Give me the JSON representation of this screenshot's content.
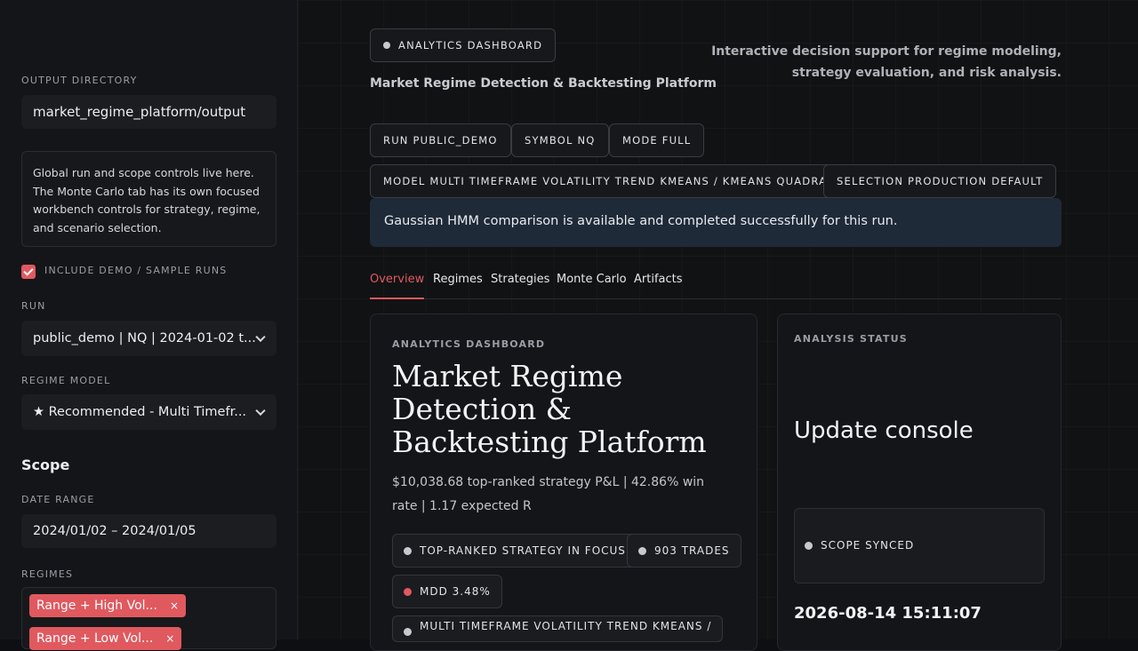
{
  "sidebar": {
    "output_directory_label": "OUTPUT DIRECTORY",
    "output_directory_value": "market_regime_platform/output",
    "note": "Global run and scope controls live here. The Monte Carlo tab has its own focused workbench controls for strategy, regime, and scenario selection.",
    "include_demo_label": "INCLUDE DEMO / SAMPLE RUNS",
    "include_demo_checked": true,
    "run_label": "RUN",
    "run_value": "public_demo | NQ | 2024-01-02 t...",
    "regime_model_label": "REGIME MODEL",
    "regime_model_value": "★ Recommended - Multi Timefr...",
    "scope_heading": "Scope",
    "date_range_label": "DATE RANGE",
    "date_range_value": "2024/01/02 – 2024/01/05",
    "regimes_label": "REGIMES",
    "regime_tags": [
      "Range + High Vol...",
      "Range + Low Vol..."
    ],
    "tag_remove": "×"
  },
  "header": {
    "badge": "ANALYTICS DASHBOARD",
    "subtitle": "Market Regime Detection & Backtesting Platform",
    "description": "Interactive decision support for regime modeling, strategy evaluation, and risk analysis.",
    "chips": [
      "RUN PUBLIC_DEMO",
      "SYMBOL NQ",
      "MODE FULL",
      "MODEL MULTI TIMEFRAME VOLATILITY TREND KMEANS / KMEANS QUADRANT",
      "SELECTION PRODUCTION DEFAULT"
    ],
    "banner": "Gaussian HMM comparison is available and completed successfully for this run."
  },
  "tabs": [
    "Overview",
    "Regimes",
    "Strategies",
    "Monte Carlo",
    "Artifacts"
  ],
  "overview_card": {
    "eyebrow": "ANALYTICS DASHBOARD",
    "title": "Market Regime Detection & Backtesting Platform",
    "summary": "$10,038.68 top-ranked strategy P&L | 42.86% win rate | 1.17 expected R",
    "pills": [
      "TOP-RANKED STRATEGY IN FOCUS",
      "903 TRADES",
      "MDD 3.48%",
      "MULTI TIMEFRAME VOLATILITY TREND KMEANS /"
    ]
  },
  "status_card": {
    "eyebrow": "ANALYSIS STATUS",
    "title": "Update console",
    "scope_status": "SCOPE SYNCED",
    "timestamp": "2026-08-14 15:11:07"
  },
  "colors": {
    "accent": "#e0595f",
    "banner_bg": "#1e2a38"
  }
}
